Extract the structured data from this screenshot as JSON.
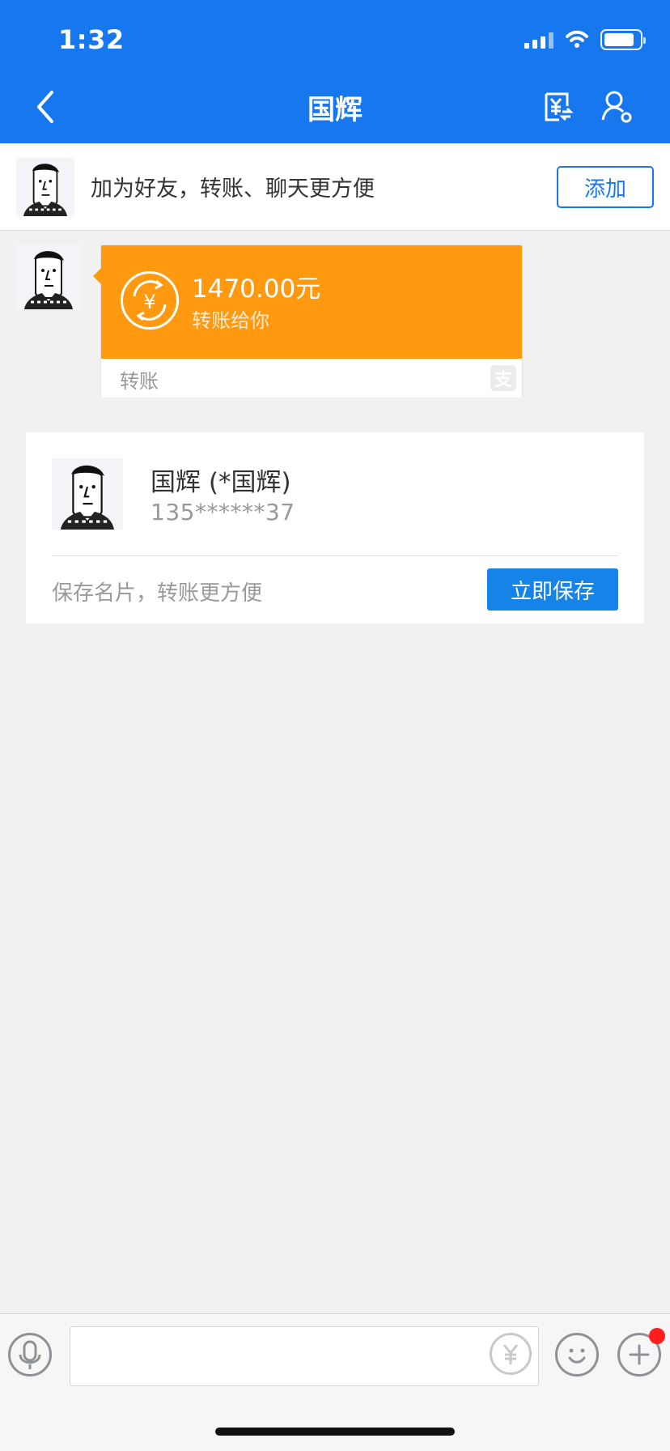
{
  "status": {
    "time": "1:32"
  },
  "nav": {
    "title": "国辉",
    "back_icon": "chevron-left-icon",
    "transfer_icon": "yuan-transfer-icon",
    "profile_icon": "person-settings-icon"
  },
  "friend_banner": {
    "text": "加为好友，转账、聊天更方便",
    "button": "添加"
  },
  "transfer_message": {
    "amount": "1470.00元",
    "subtitle": "转账给你",
    "label": "转账",
    "coin_symbol": "¥",
    "alipay_mark": "支"
  },
  "contact_card": {
    "name": "国辉 (*国辉)",
    "phone": "135******37",
    "hint": "保存名片，转账更方便",
    "button": "立即保存"
  },
  "input_bar": {
    "voice_icon": "microphone-icon",
    "pay_icon": "yuan-circle-icon",
    "emoji_icon": "smile-icon",
    "plus_icon": "plus-icon",
    "has_notification_dot": true
  },
  "colors": {
    "nav_blue": "#1677ee",
    "transfer_orange": "#ff9a10",
    "save_blue": "#1683e8",
    "dot_red": "#ff1f1f"
  }
}
